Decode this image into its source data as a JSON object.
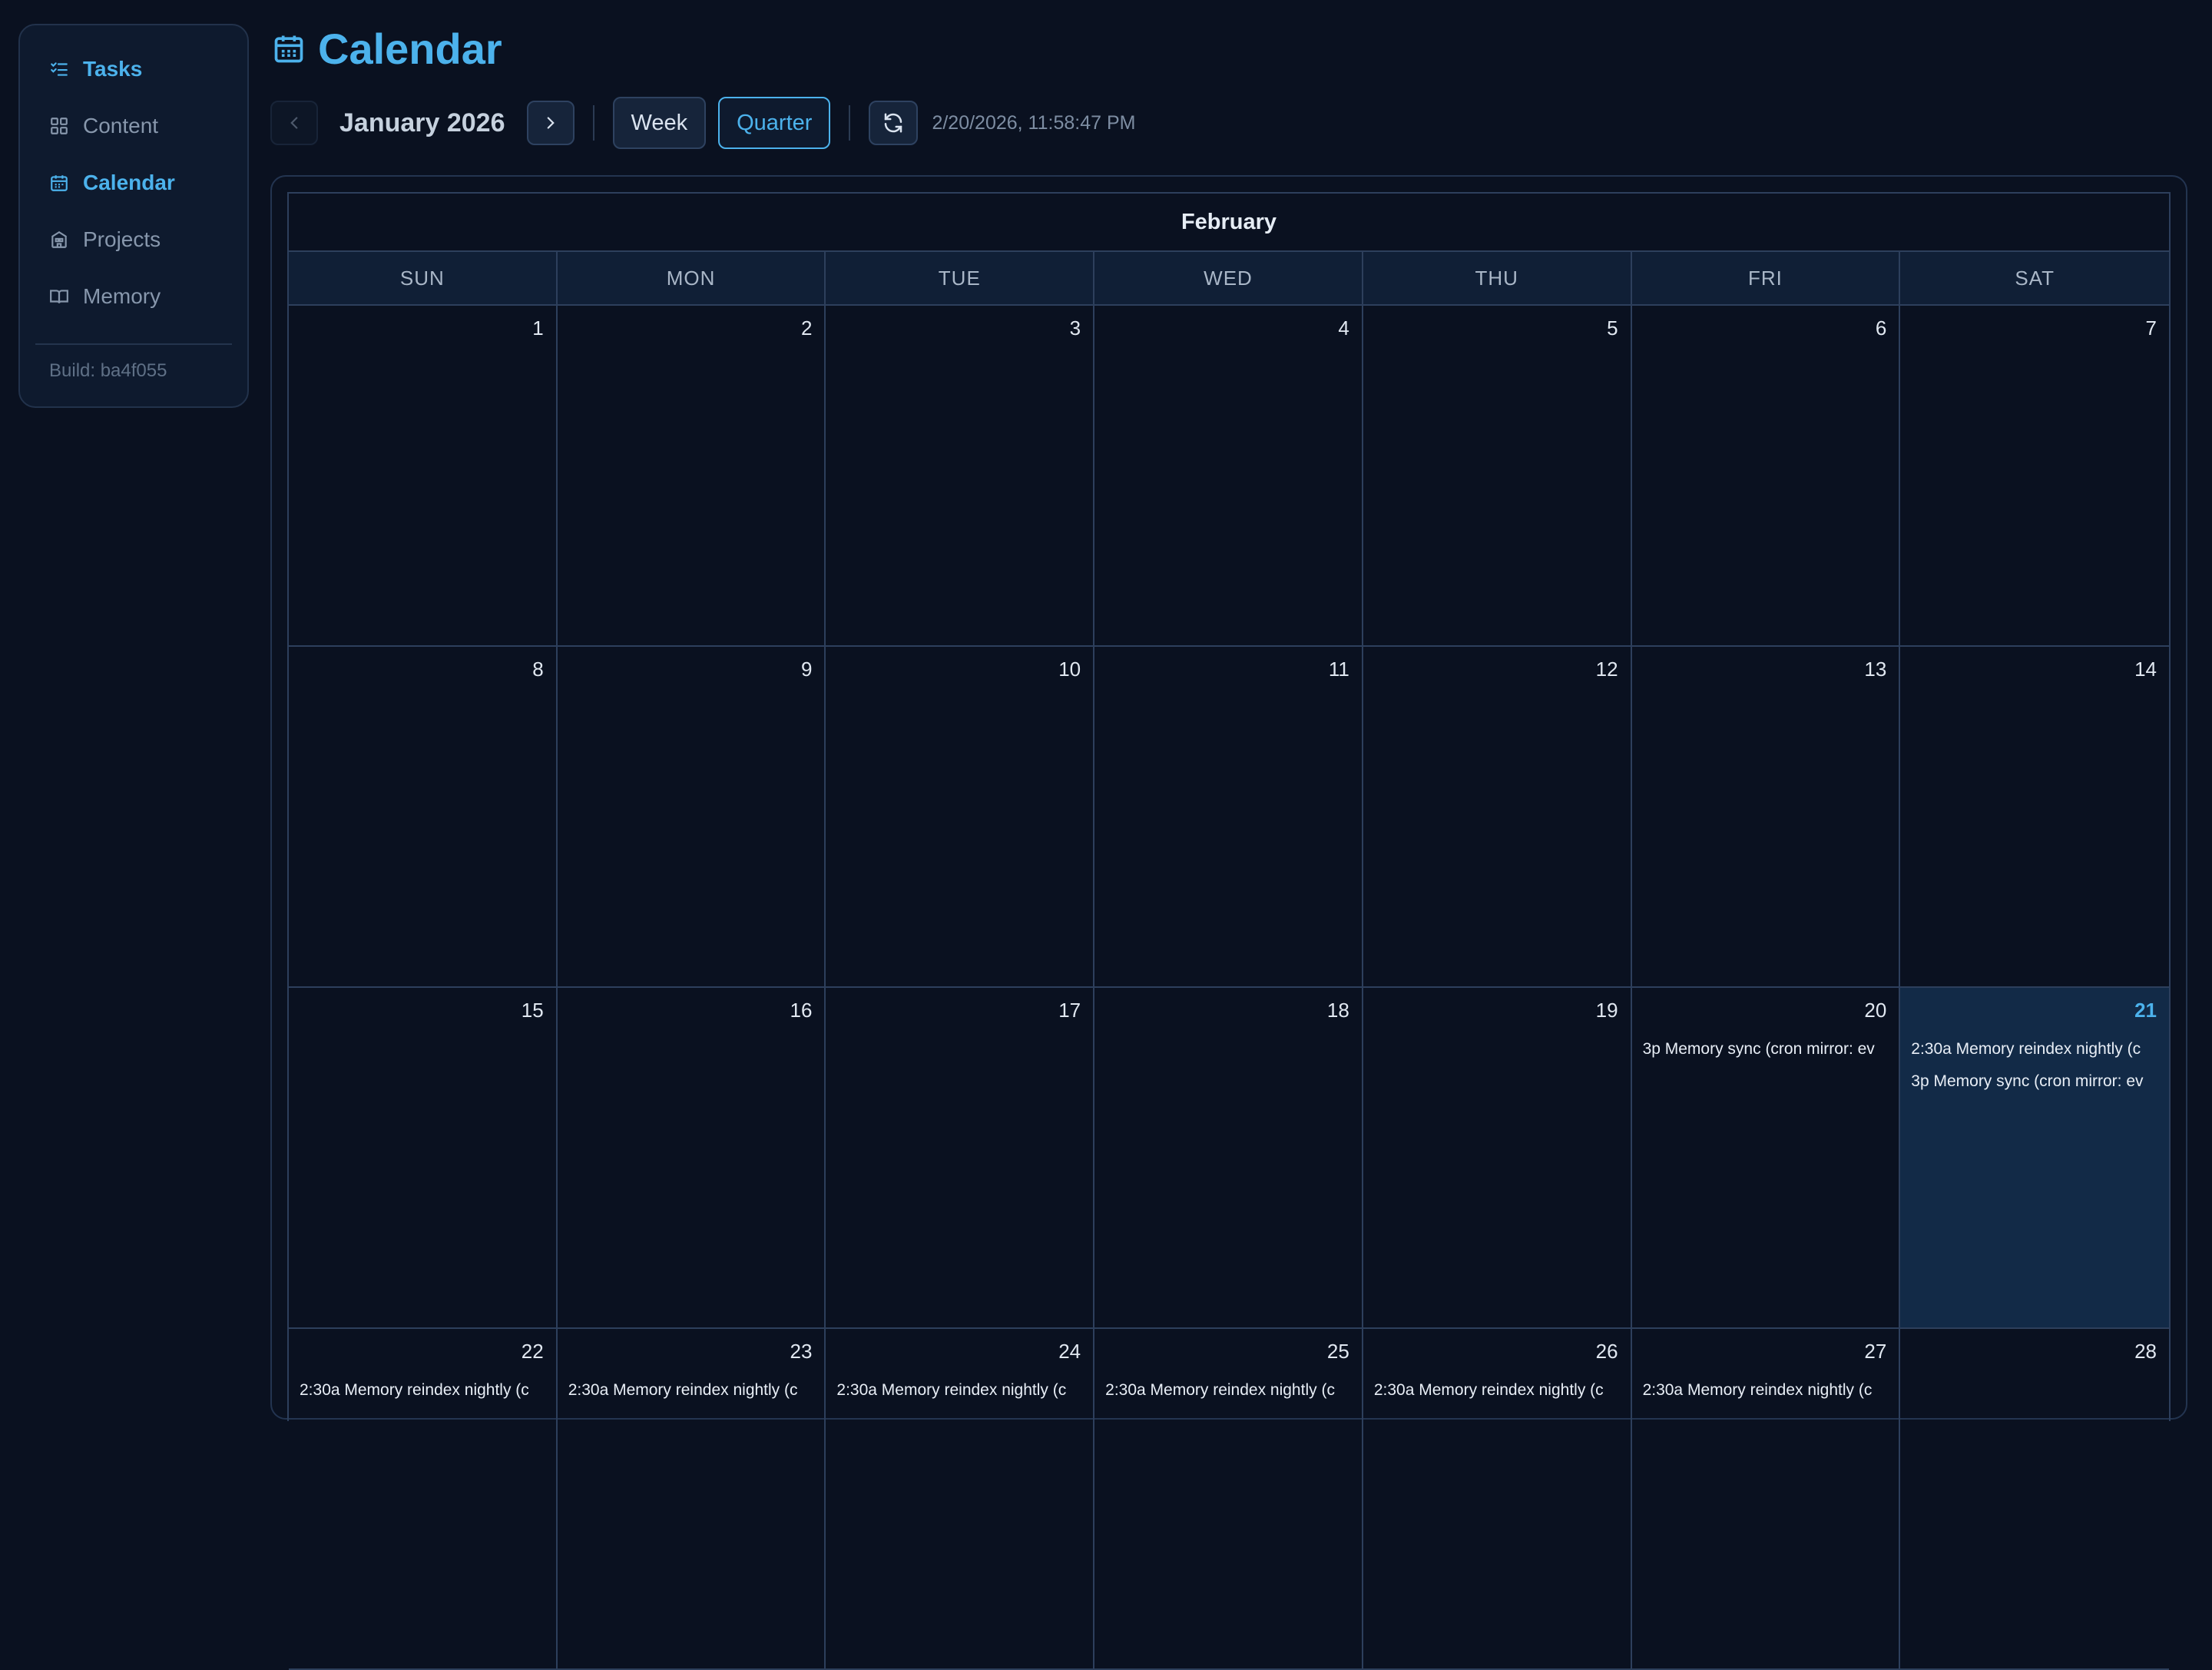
{
  "sidebar": {
    "items": [
      {
        "label": "Tasks",
        "icon": "tasks-icon"
      },
      {
        "label": "Content",
        "icon": "content-icon"
      },
      {
        "label": "Calendar",
        "icon": "calendar-icon"
      },
      {
        "label": "Projects",
        "icon": "projects-icon"
      },
      {
        "label": "Memory",
        "icon": "memory-icon"
      }
    ],
    "build": "Build: ba4f055"
  },
  "header": {
    "title": "Calendar",
    "icon": "calendar-icon"
  },
  "toolbar": {
    "month_label": "January 2026",
    "week_label": "Week",
    "quarter_label": "Quarter",
    "selected_view": "Quarter",
    "timestamp": "2/20/2026, 11:58:47 PM"
  },
  "calendar": {
    "month_name": "February",
    "weekdays": [
      "SUN",
      "MON",
      "TUE",
      "WED",
      "THU",
      "FRI",
      "SAT"
    ],
    "today": 21,
    "weeks": [
      [
        {
          "day": "1",
          "events": []
        },
        {
          "day": "2",
          "events": []
        },
        {
          "day": "3",
          "events": []
        },
        {
          "day": "4",
          "events": []
        },
        {
          "day": "5",
          "events": []
        },
        {
          "day": "6",
          "events": []
        },
        {
          "day": "7",
          "events": []
        }
      ],
      [
        {
          "day": "8",
          "events": []
        },
        {
          "day": "9",
          "events": []
        },
        {
          "day": "10",
          "events": []
        },
        {
          "day": "11",
          "events": []
        },
        {
          "day": "12",
          "events": []
        },
        {
          "day": "13",
          "events": []
        },
        {
          "day": "14",
          "events": []
        }
      ],
      [
        {
          "day": "15",
          "events": []
        },
        {
          "day": "16",
          "events": []
        },
        {
          "day": "17",
          "events": []
        },
        {
          "day": "18",
          "events": []
        },
        {
          "day": "19",
          "events": []
        },
        {
          "day": "20",
          "events": [
            "3p Memory sync (cron mirror: ev"
          ]
        },
        {
          "day": "21",
          "events": [
            "2:30a Memory reindex nightly (c",
            "3p Memory sync (cron mirror: ev"
          ]
        }
      ],
      [
        {
          "day": "22",
          "events": [
            "2:30a Memory reindex nightly (c"
          ]
        },
        {
          "day": "23",
          "events": [
            "2:30a Memory reindex nightly (c"
          ]
        },
        {
          "day": "24",
          "events": [
            "2:30a Memory reindex nightly (c"
          ]
        },
        {
          "day": "25",
          "events": [
            "2:30a Memory reindex nightly (c"
          ]
        },
        {
          "day": "26",
          "events": [
            "2:30a Memory reindex nightly (c"
          ]
        },
        {
          "day": "27",
          "events": [
            "2:30a Memory reindex nightly (c"
          ]
        },
        {
          "day": "28",
          "events": []
        }
      ]
    ]
  },
  "colors": {
    "accent": "#4cb2ec",
    "background": "#0a1120",
    "today_cell": "#122a47"
  }
}
